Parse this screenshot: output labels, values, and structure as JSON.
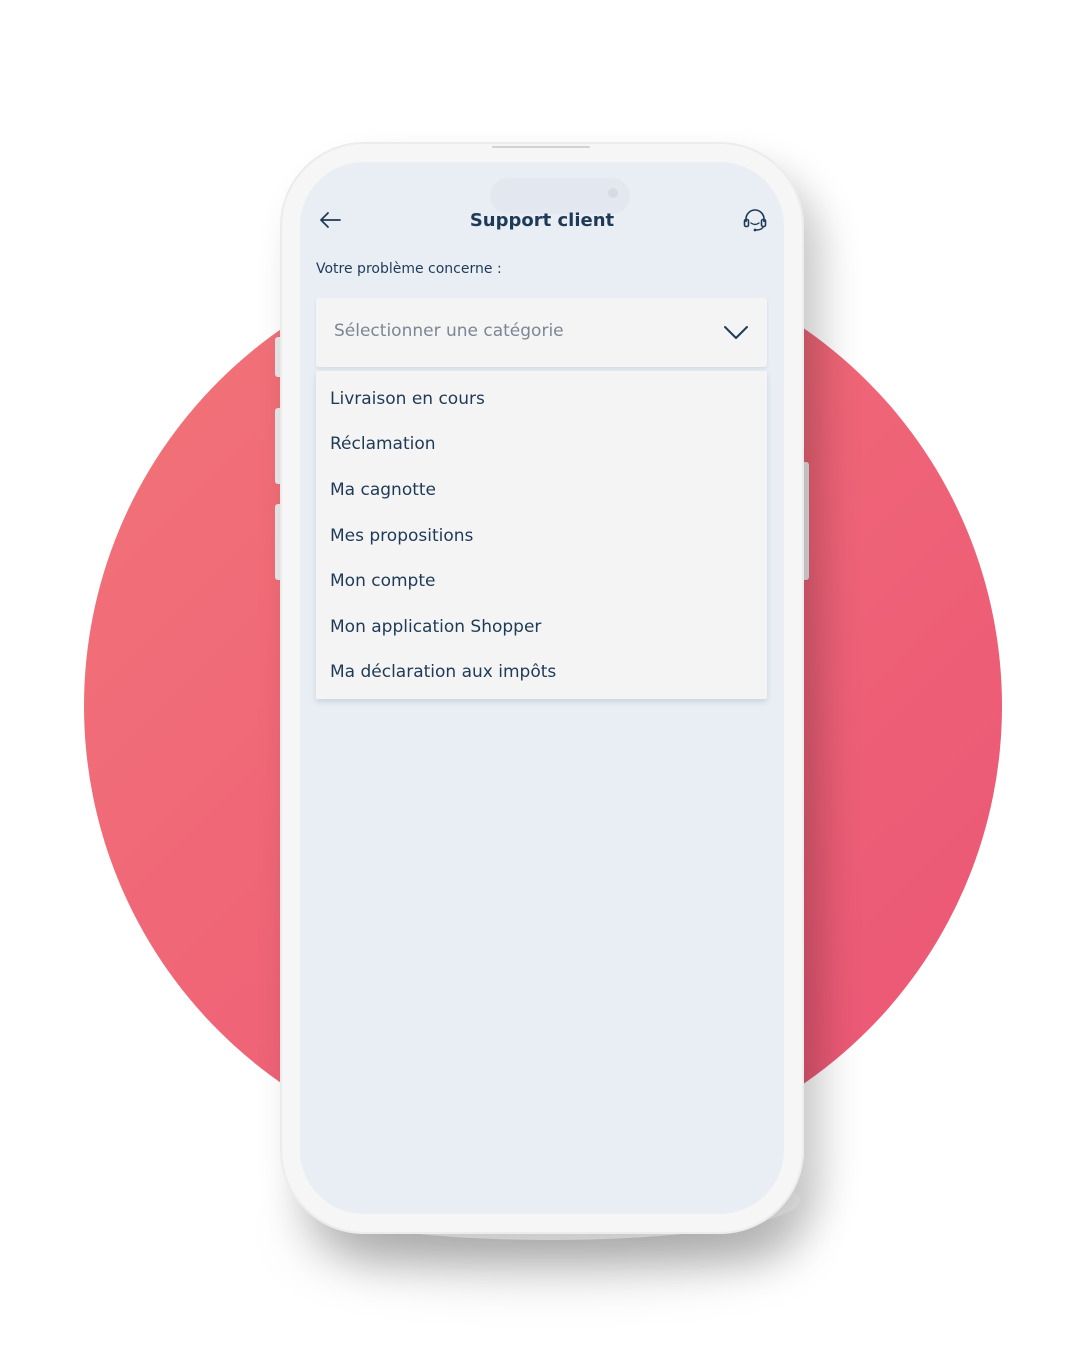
{
  "screen": {
    "title": "Support client",
    "prompt_label": "Votre problème concerne :",
    "select": {
      "placeholder": "Sélectionner une catégorie",
      "expanded": true
    },
    "options": [
      "Livraison en cours",
      "Réclamation",
      "Ma cagnotte",
      "Mes propositions",
      "Mon compte",
      "Mon application Shopper",
      "Ma déclaration aux impôts"
    ]
  },
  "icons": {
    "back": "arrow-left-icon",
    "support": "headset-icon",
    "dropdown": "chevron-down-icon"
  },
  "colors": {
    "background_circle": "#ef6377",
    "screen_background": "#e9eef5",
    "text_primary": "#1f3a56",
    "placeholder_text": "#7a8795",
    "select_background": "#f4f4f4"
  }
}
